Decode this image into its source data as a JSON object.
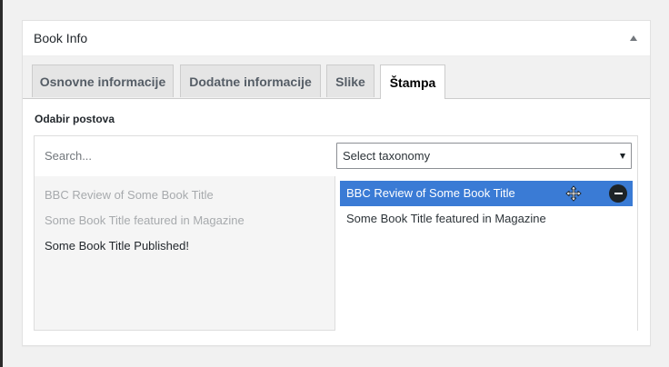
{
  "metabox": {
    "title": "Book Info"
  },
  "tabs": [
    {
      "label": "Osnovne informacije"
    },
    {
      "label": "Dodatne informacije"
    },
    {
      "label": "Slike"
    },
    {
      "label": "Štampa"
    }
  ],
  "active_tab": "Štampa",
  "section_label": "Odabir postova",
  "search": {
    "placeholder": "Search...",
    "value": ""
  },
  "taxonomy_select": {
    "selected": "Select taxonomy"
  },
  "available_posts": [
    {
      "title": "BBC Review of Some Book Title",
      "state": "disabled"
    },
    {
      "title": "Some Book Title featured in Magazine",
      "state": "disabled"
    },
    {
      "title": "Some Book Title Published!",
      "state": "enabled"
    }
  ],
  "selected_posts": [
    {
      "title": "BBC Review of Some Book Title",
      "highlighted": true
    },
    {
      "title": "Some Book Title featured in Magazine",
      "highlighted": false
    }
  ],
  "icons": {
    "toggle": "arrow-up-icon",
    "select_arrow": "caret-down-icon",
    "drag": "move-icon",
    "remove": "remove-icon"
  },
  "colors": {
    "highlight": "#3a7bd5",
    "disabled_text": "#a7aaad",
    "tab_bg": "#e5e5e5"
  }
}
